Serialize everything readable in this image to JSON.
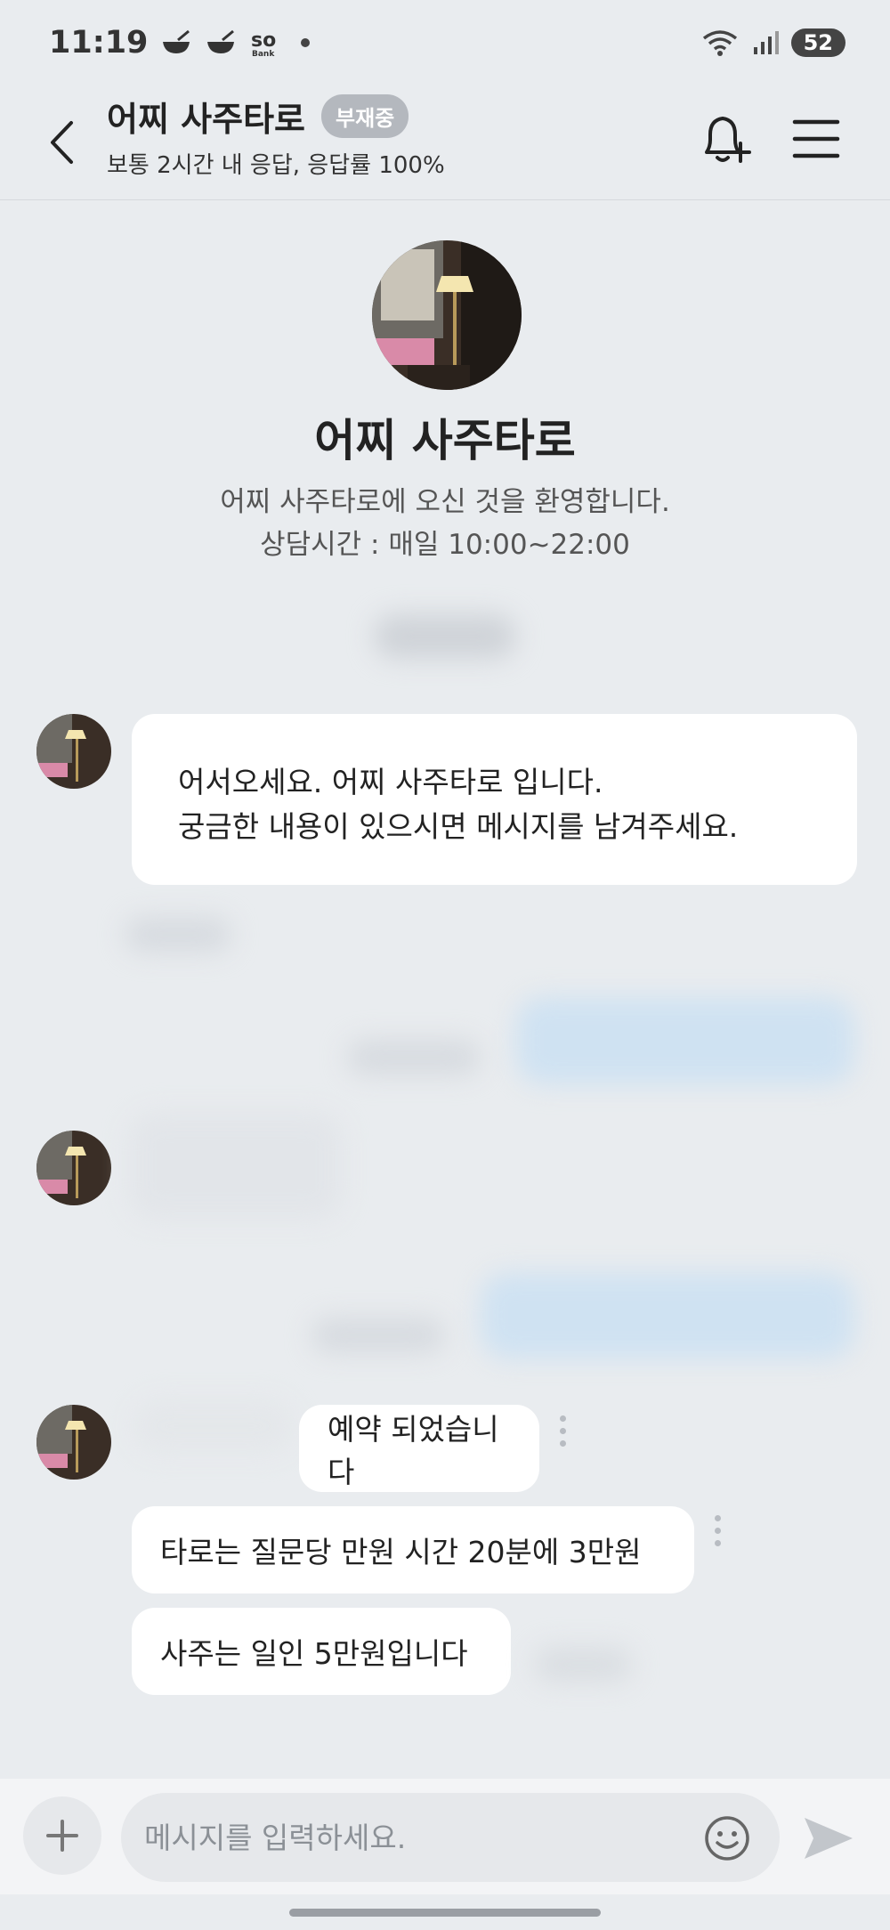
{
  "status_bar": {
    "time": "11:19",
    "bank_label": "Sol\nBank",
    "battery": "52"
  },
  "header": {
    "title": "어찌 사주타로",
    "badge": "부재중",
    "subtitle": "보통 2시간 내 응답, 응답률 100%"
  },
  "profile": {
    "name": "어찌 사주타로",
    "welcome_line1": "어찌 사주타로에 오신 것을 환영합니다.",
    "welcome_line2": "상담시간 : 매일 10:00~22:00"
  },
  "messages": {
    "greeting_line1": "어서오세요. 어찌 사주타로 입니다.",
    "greeting_line2": "궁금한 내용이 있으시면 메시지를 남겨주세요.",
    "reserved": "예약 되었습니다",
    "tarot_price": "타로는 질문당 만원 시간 20분에 3만원",
    "saju_price": "사주는 일인 5만원입니다"
  },
  "input": {
    "placeholder": "메시지를 입력하세요."
  },
  "colors": {
    "background": "#e9ecef",
    "bubble": "#ffffff",
    "badge": "#b4b8be",
    "sent_bubble": "#cfe2f2"
  }
}
